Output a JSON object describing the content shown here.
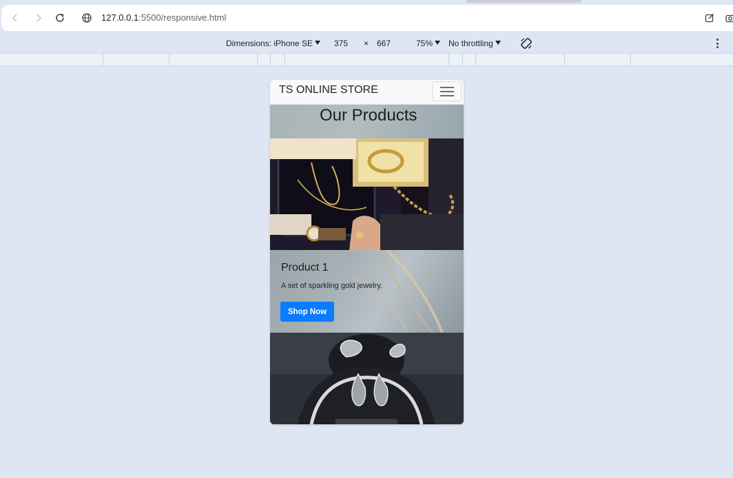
{
  "browser": {
    "url_host": "127.0.0.1",
    "url_rest": ":5500/responsive.html",
    "icons": [
      "back-icon",
      "forward-icon",
      "reload-icon",
      "site-info-icon",
      "edit-icon",
      "screenshot-icon"
    ]
  },
  "device_toolbar": {
    "dimensions_label": "Dimensions: iPhone SE",
    "width": "375",
    "times": "×",
    "height": "667",
    "zoom": "75%",
    "throttling": "No throttling",
    "icons": [
      "rotate-icon",
      "more-options-icon"
    ]
  },
  "page": {
    "navbar": {
      "brand": "TS ONLINE STORE",
      "toggler_icon": "hamburger-icon"
    },
    "hero": {
      "title": "Our Products"
    },
    "card": {
      "title": "Product 1",
      "text": "A set of sparkling gold jewelry.",
      "button": "Shop Now"
    }
  },
  "colors": {
    "page_background": "#dfe6f3",
    "button_primary": "#0a7cff",
    "navbar_background": "#f8f9fa"
  }
}
